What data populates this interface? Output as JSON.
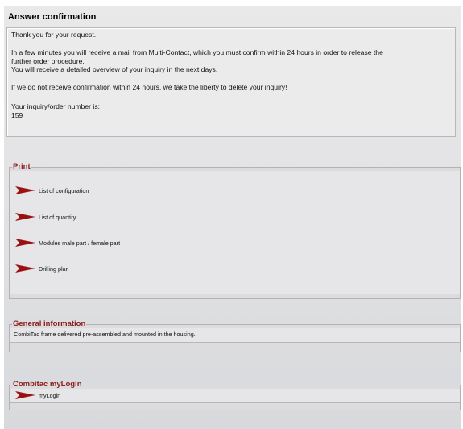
{
  "heading": "Answer confirmation",
  "confirmation": {
    "line1": "Thank you for your request.",
    "line2": "In a few minutes you will receive a mail from Multi-Contact, which you must confirm within 24 hours in order to release the",
    "line3": "further order procedure.",
    "line4": "You will receive a detailed overview of your inquiry in the next days.",
    "line5": "If we do not receive confirmation within 24 hours, we take the liberty to delete your inquiry!",
    "line6": "Your inquiry/order number is:",
    "order_number": "159"
  },
  "print": {
    "legend": "Print",
    "items": [
      {
        "label": "List of configuration",
        "icon": "arrow-right-icon"
      },
      {
        "label": "List of quantity",
        "icon": "arrow-right-icon"
      },
      {
        "label": "Modules male part / female part",
        "icon": "arrow-right-icon"
      },
      {
        "label": "Drilling plan",
        "icon": "arrow-right-icon"
      }
    ]
  },
  "general_info": {
    "legend": "General information",
    "text": "CombiTac frame delivered pre-assembled and mounted in the housing."
  },
  "mylogin": {
    "legend": "Combitac myLogin",
    "link_label": "myLogin",
    "icon": "arrow-right-icon"
  },
  "colors": {
    "legend_red": "#8b1a1a",
    "arrow_red": "#9b1111",
    "panel_bg": "#e6e6e8"
  }
}
